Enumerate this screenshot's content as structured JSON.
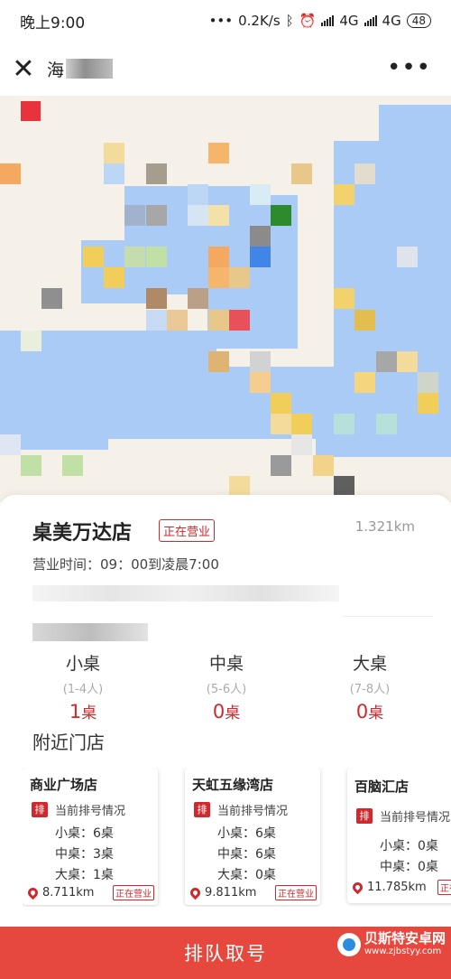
{
  "status_bar": {
    "time": "晚上9:00",
    "speed": "0.2K/s",
    "network1": "4G",
    "network2": "4G",
    "battery": "48"
  },
  "header": {
    "title": "海"
  },
  "store": {
    "name": "桌美万达店",
    "status": "正在营业",
    "distance": "1.321km",
    "hours": "营业时间：09：00到凌晨7:00"
  },
  "tables": [
    {
      "name": "小桌",
      "capacity": "(1-4人)",
      "count": "1",
      "unit": "桌"
    },
    {
      "name": "中桌",
      "capacity": "(5-6人)",
      "count": "0",
      "unit": "桌"
    },
    {
      "name": "大桌",
      "capacity": "(7-8人)",
      "count": "0",
      "unit": "桌"
    }
  ],
  "nearby": {
    "title": "附近门店",
    "tag": "排",
    "status_label": "当前排号情况",
    "stores": [
      {
        "name": "商业广场店",
        "small": "小桌：6桌",
        "medium": "中桌：3桌",
        "large": "大桌：1桌",
        "distance": "8.711km",
        "badge": "正在营业"
      },
      {
        "name": "天虹五缘湾店",
        "small": "小桌：6桌",
        "medium": "中桌：6桌",
        "large": "大桌：0桌",
        "distance": "9.811km",
        "badge": "正在营业"
      },
      {
        "name": "百脑汇店",
        "small": "小桌：0桌",
        "medium": "中桌：0桌",
        "large": "",
        "distance": "11.785km",
        "badge": "正在营业"
      }
    ]
  },
  "queue_button": "排队取号",
  "watermark": {
    "name": "贝斯特安卓网",
    "url": "www.zjbstyy.com"
  },
  "icons": {
    "close": "close-icon",
    "more": "more-icon",
    "location": "location-pin-icon"
  },
  "colors": {
    "accent": "#d0282d",
    "button": "#e6483e",
    "water": "#a9cbf5"
  }
}
